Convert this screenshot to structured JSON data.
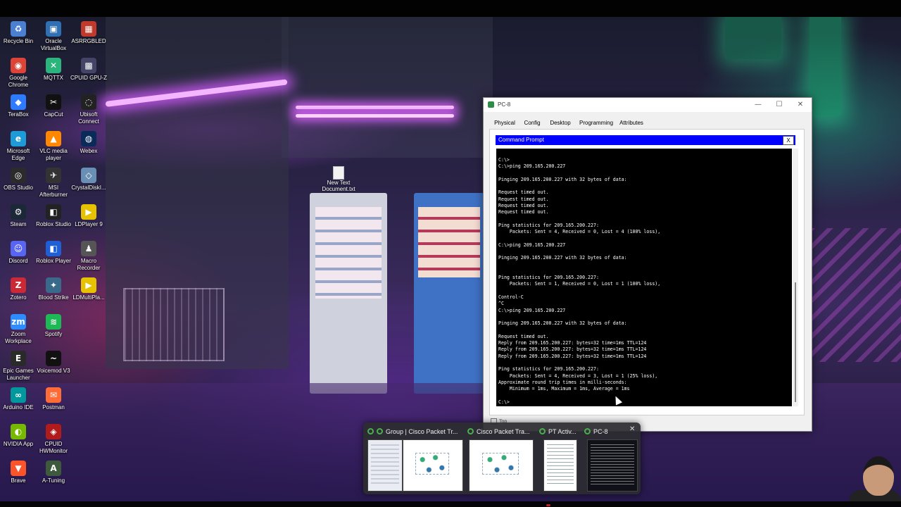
{
  "desktop": {
    "icons_col1": [
      {
        "label": "Recycle Bin",
        "icon": "recycle-bin-icon",
        "color": "#4a7fd1",
        "glyph": "♻"
      },
      {
        "label": "Google Chrome",
        "icon": "chrome-icon",
        "color": "#db4437",
        "glyph": "◉"
      },
      {
        "label": "TeraBox",
        "icon": "terabox-icon",
        "color": "#2f7bff",
        "glyph": "◆"
      },
      {
        "label": "Microsoft Edge",
        "icon": "edge-icon",
        "color": "#1d9bd7",
        "glyph": "e"
      },
      {
        "label": "OBS Studio",
        "icon": "obs-icon",
        "color": "#2b2b2b",
        "glyph": "◎"
      },
      {
        "label": "Steam",
        "icon": "steam-icon",
        "color": "#1b2838",
        "glyph": "⚙"
      },
      {
        "label": "Discord",
        "icon": "discord-icon",
        "color": "#5865f2",
        "glyph": "☺"
      },
      {
        "label": "Zotero",
        "icon": "zotero-icon",
        "color": "#cc2936",
        "glyph": "Z"
      },
      {
        "label": "Zoom Workplace",
        "icon": "zoom-icon",
        "color": "#2d8cff",
        "glyph": "zm"
      },
      {
        "label": "Epic Games Launcher",
        "icon": "epic-games-icon",
        "color": "#2a2a2a",
        "glyph": "E"
      },
      {
        "label": "Arduino IDE",
        "icon": "arduino-icon",
        "color": "#00979d",
        "glyph": "∞"
      },
      {
        "label": "NVIDIA App",
        "icon": "nvidia-icon",
        "color": "#76b900",
        "glyph": "◐"
      },
      {
        "label": "Brave",
        "icon": "brave-icon",
        "color": "#fb542b",
        "glyph": "▼"
      }
    ],
    "icons_col2": [
      {
        "label": "Oracle VirtualBox",
        "icon": "virtualbox-icon",
        "color": "#2f6fb4",
        "glyph": "▣"
      },
      {
        "label": "MQTTX",
        "icon": "mqttx-icon",
        "color": "#2bb57c",
        "glyph": "✕"
      },
      {
        "label": "CapCut",
        "icon": "capcut-icon",
        "color": "#111111",
        "glyph": "✂"
      },
      {
        "label": "VLC media player",
        "icon": "vlc-icon",
        "color": "#ff8800",
        "glyph": "▲"
      },
      {
        "label": "MSI Afterburner",
        "icon": "msi-afterburner-icon",
        "color": "#333333",
        "glyph": "✈"
      },
      {
        "label": "Roblox Studio",
        "icon": "roblox-studio-icon",
        "color": "#222222",
        "glyph": "◧"
      },
      {
        "label": "Roblox Player",
        "icon": "roblox-player-icon",
        "color": "#1f5fd6",
        "glyph": "◧"
      },
      {
        "label": "Blood Strike",
        "icon": "blood-strike-icon",
        "color": "#3a6a8a",
        "glyph": "✦"
      },
      {
        "label": "Spotify",
        "icon": "spotify-icon",
        "color": "#1db954",
        "glyph": "≋"
      },
      {
        "label": "Voicemod V3",
        "icon": "voicemod-icon",
        "color": "#111111",
        "glyph": "~"
      },
      {
        "label": "Postman",
        "icon": "postman-icon",
        "color": "#ff6c37",
        "glyph": "✉"
      },
      {
        "label": "CPUID HWMonitor",
        "icon": "hwmonitor-icon",
        "color": "#b01b1b",
        "glyph": "◈"
      },
      {
        "label": "A-Tuning",
        "icon": "a-tuning-icon",
        "color": "#3d5a3d",
        "glyph": "A"
      }
    ],
    "icons_col3": [
      {
        "label": "ASRRGBLED",
        "icon": "asrrgbled-icon",
        "color": "#c0392b",
        "glyph": "▦"
      },
      {
        "label": "CPUID GPU-Z",
        "icon": "gpu-z-icon",
        "color": "#444466",
        "glyph": "▩"
      },
      {
        "label": "Ubisoft Connect",
        "icon": "ubisoft-icon",
        "color": "#222222",
        "glyph": "◌"
      },
      {
        "label": "Webex",
        "icon": "webex-icon",
        "color": "#0a2a5a",
        "glyph": "◍"
      },
      {
        "label": "CrystalDiskI...",
        "icon": "crystaldisk-icon",
        "color": "#6a8fb5",
        "glyph": "◇"
      },
      {
        "label": "LDPlayer 9",
        "icon": "ldplayer-icon",
        "color": "#e6c200",
        "glyph": "▶"
      },
      {
        "label": "Macro Recorder",
        "icon": "macro-recorder-icon",
        "color": "#555555",
        "glyph": "♟"
      },
      {
        "label": "LDMultiPla...",
        "icon": "ldmultiplayer-icon",
        "color": "#e6c200",
        "glyph": "▶"
      }
    ],
    "file_icon": {
      "label": "New Text Document.txt"
    }
  },
  "window": {
    "title": "PC-8",
    "minimize": "—",
    "maximize": "☐",
    "close": "✕",
    "tabs": [
      "Physical",
      "Config",
      "Desktop",
      "Programming",
      "Attributes"
    ],
    "active_tab": "Desktop",
    "cmd_title": "Command Prompt",
    "cmd_close": "X",
    "top_checkbox_label": "Top",
    "terminal_lines": [
      "",
      "C:\\>",
      "C:\\>ping 209.165.200.227",
      "",
      "Pinging 209.165.200.227 with 32 bytes of data:",
      "",
      "Request timed out.",
      "Request timed out.",
      "Request timed out.",
      "Request timed out.",
      "",
      "Ping statistics for 209.165.200.227:",
      "    Packets: Sent = 4, Received = 0, Lost = 4 (100% loss),",
      "",
      "C:\\>ping 209.165.200.227",
      "",
      "Pinging 209.165.200.227 with 32 bytes of data:",
      "",
      "",
      "Ping statistics for 209.165.200.227:",
      "    Packets: Sent = 1, Received = 0, Lost = 1 (100% loss),",
      "",
      "Control-C",
      "^C",
      "C:\\>ping 209.165.200.227",
      "",
      "Pinging 209.165.200.227 with 32 bytes of data:",
      "",
      "Request timed out.",
      "Reply from 209.165.200.227: bytes=32 time=1ms TTL=124",
      "Reply from 209.165.200.227: bytes=32 time=1ms TTL=124",
      "Reply from 209.165.200.227: bytes=32 time=1ms TTL=124",
      "",
      "Ping statistics for 209.165.200.227:",
      "    Packets: Sent = 4, Received = 3, Lost = 1 (25% loss),",
      "Approximate round trip times in milli-seconds:",
      "    Minimum = 1ms, Maximum = 1ms, Average = 1ms",
      "",
      "C:\\>"
    ]
  },
  "previews": [
    {
      "title": "Group | Cisco Packet Tr...",
      "kind": "group"
    },
    {
      "title": "Cisco Packet Tra...",
      "kind": "network"
    },
    {
      "title": "PT Activ...",
      "kind": "document"
    },
    {
      "title": "PC-8",
      "kind": "terminal",
      "close": "✕"
    }
  ]
}
